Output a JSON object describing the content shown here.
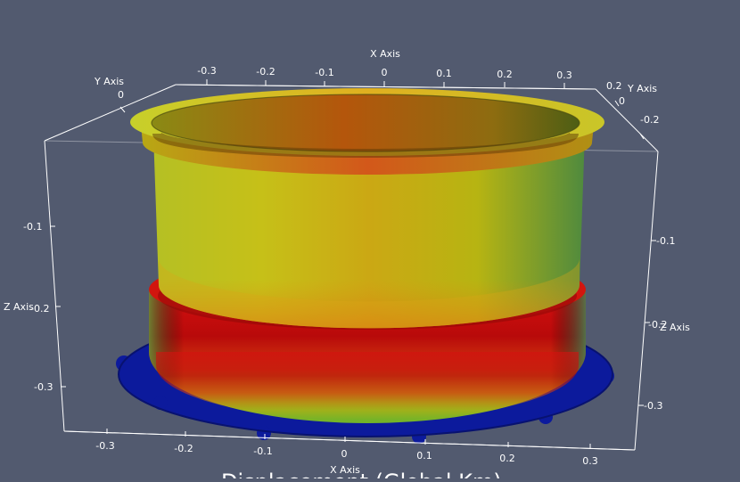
{
  "colors": {
    "background": "#525a6f",
    "axes": "#ffffff",
    "scalar_low": "#0a1aa0",
    "scalar_mid": "#b9b800",
    "scalar_high": "#c81208"
  },
  "axes": {
    "x_top": {
      "title": "X Axis",
      "ticks": [
        "-0.3",
        "-0.2",
        "-0.1",
        "0",
        "0.1",
        "0.2",
        "0.3"
      ]
    },
    "x_bottom": {
      "title": "X Axis",
      "ticks": [
        "-0.3",
        "-0.2",
        "-0.1",
        "0",
        "0.1",
        "0.2",
        "0.3"
      ]
    },
    "y_left": {
      "title": "Y Axis",
      "ticks": [
        "0"
      ]
    },
    "y_right": {
      "title": "Y Axis",
      "ticks": [
        "0.2",
        "0",
        "-0.2"
      ]
    },
    "z_left": {
      "title": "Z Axis",
      "ticks": [
        "-0.1",
        "-0.2",
        "-0.3"
      ]
    },
    "z_right": {
      "title": "Z Axis",
      "ticks": [
        "-0.1",
        "-0.2",
        "-0.3"
      ]
    }
  },
  "overlay_text": "Displacement (Global Km)"
}
